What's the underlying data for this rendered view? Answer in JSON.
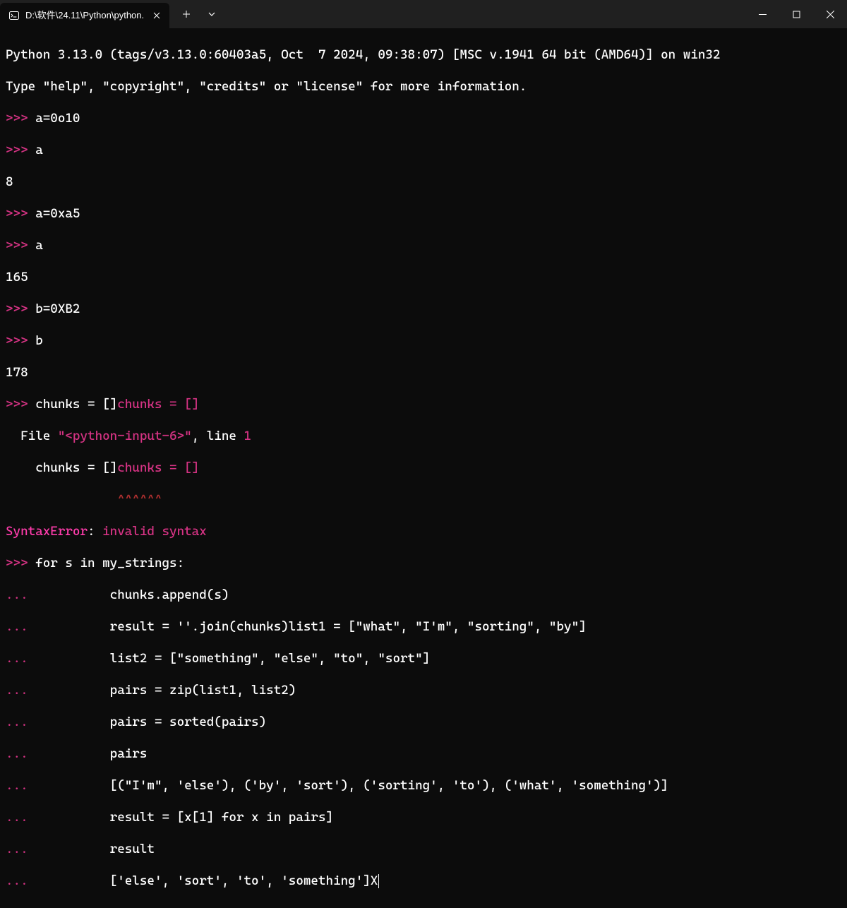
{
  "titlebar": {
    "tab_title": "D:\\软件\\24.11\\Python\\python."
  },
  "terminal": {
    "header1": "Python 3.13.0 (tags/v3.13.0:60403a5, Oct  7 2024, 09:38:07) [MSC v.1941 64 bit (AMD64)] on win32",
    "header2": "Type \"help\", \"copyright\", \"credits\" or \"license\" for more information.",
    "prompt": ">>> ",
    "cont": "... ",
    "in1": "a=0o10",
    "in2": "a",
    "out2": "8",
    "in3": "a=0xa5",
    "in4": "a",
    "out4": "165",
    "in5": "b=0XB2",
    "in6": "b",
    "out6": "178",
    "in7_a": "chunks = []",
    "in7_b": "chunks = []",
    "err_file_pre": "  File ",
    "err_file_name": "\"<python-input-6>\"",
    "err_file_post": ", line ",
    "err_line_no": "1",
    "err_echo_indent": "    ",
    "err_caret_indent": "               ",
    "err_caret": "^^^^^^",
    "err_type": "SyntaxError",
    "err_colon": ": ",
    "err_msg": "invalid syntax",
    "in8": "for s in my_strings:",
    "c_indent": "          ",
    "c1": "chunks.append(s)",
    "c2": "result = ''.join(chunks)list1 = [\"what\", \"I'm\", \"sorting\", \"by\"]",
    "c3": "list2 = [\"something\", \"else\", \"to\", \"sort\"]",
    "c4": "pairs = zip(list1, list2)",
    "c5": "pairs = sorted(pairs)",
    "c6": "pairs",
    "c7": "[(\"I'm\", 'else'), ('by', 'sort'), ('sorting', 'to'), ('what', 'something')]",
    "c8": "result = [x[1] for x in pairs]",
    "c9": "result",
    "c10": "['else', 'sort', 'to', 'something']X"
  }
}
